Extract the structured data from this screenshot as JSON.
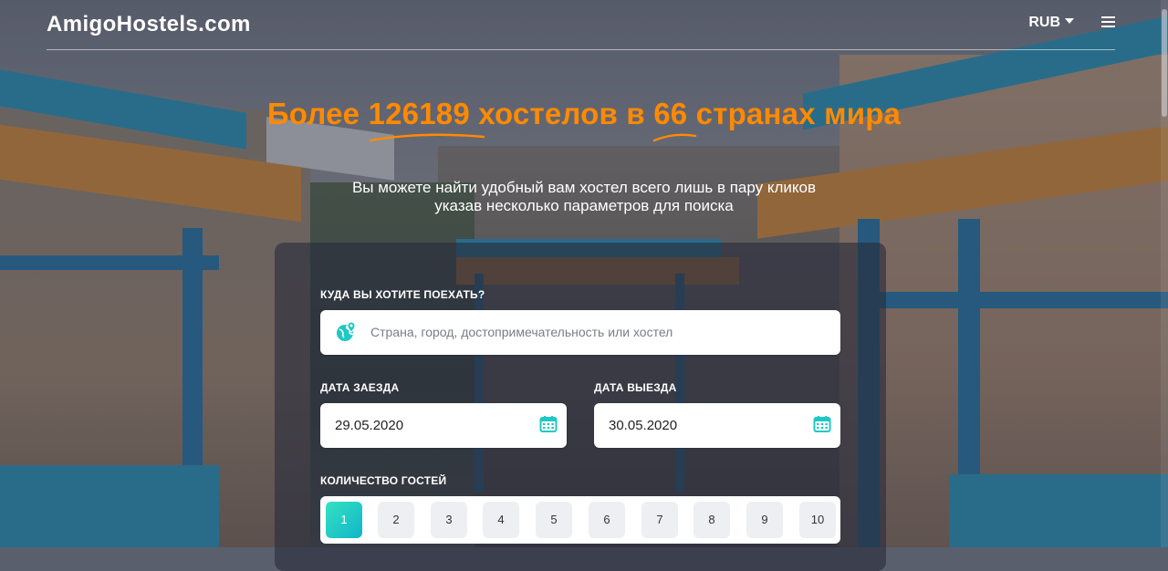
{
  "header": {
    "logo": "AmigoHostels.com",
    "currency": "RUB"
  },
  "hero": {
    "title_before": "Более ",
    "hostels_count": "126189",
    "title_mid": " хостелов в ",
    "countries_count": "66",
    "title_after": " странах мира",
    "subtitle_line1": "Вы можете найти удобный вам хостел всего лишь в пару кликов",
    "subtitle_line2": "указав несколько параметров для поиска"
  },
  "search": {
    "destination_label": "КУДА ВЫ ХОТИТЕ ПОЕХАТЬ?",
    "destination_placeholder": "Страна, город, достопримечательность или хостел",
    "checkin_label": "ДАТА ЗАЕЗДА",
    "checkin_value": "29.05.2020",
    "checkout_label": "ДАТА ВЫЕЗДА",
    "checkout_value": "30.05.2020",
    "guests_label": "КОЛИЧЕСТВО ГОСТЕЙ",
    "guest_options": [
      "1",
      "2",
      "3",
      "4",
      "5",
      "6",
      "7",
      "8",
      "9",
      "10"
    ],
    "guests_selected": "1"
  },
  "colors": {
    "accent_orange": "#ff8a00",
    "accent_teal": "#1ec8c4"
  },
  "icons": [
    "globe-pin-icon",
    "calendar-icon",
    "caret-down-icon",
    "menu-icon"
  ]
}
